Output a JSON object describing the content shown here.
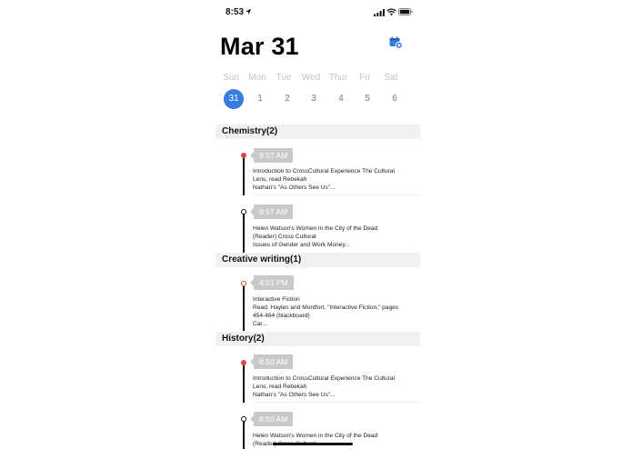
{
  "status_bar": {
    "time": "8:53"
  },
  "header": {
    "title": "Mar 31"
  },
  "week": {
    "days": [
      "Sun",
      "Mon",
      "Tue",
      "Wed",
      "Thur",
      "Fri",
      "Sat"
    ],
    "dates": [
      "31",
      "1",
      "2",
      "3",
      "4",
      "5",
      "6"
    ],
    "selected_index": 0
  },
  "sections": [
    {
      "title": "Chemistry(2)",
      "events": [
        {
          "time": "9:57 AM",
          "lines": [
            "Introduction to CrossCultural Experience The Cultural",
            "Lens, read Rebekah",
            "Nathan's \"As Others See Us\"..."
          ],
          "dot": "red"
        },
        {
          "time": "9:57 AM",
          "lines": [
            "Helen Watson's Women in the City of the Dead",
            "(Reader) Cross Cultural",
            "Issues of Gender and Work Money..."
          ],
          "dot": "hollow"
        }
      ]
    },
    {
      "title": "Creative writing(1)",
      "events": [
        {
          "time": "4:01 PM",
          "lines": [
            "Interactive Fiction",
            "Read: Hayles and Montfort, \"Interactive Fiction,\" pages",
            "454-464 (blackboard)",
            "Car..."
          ],
          "dot": "hollow-red"
        }
      ]
    },
    {
      "title": "History(2)",
      "events": [
        {
          "time": "8:50 AM",
          "lines": [
            "Introduction to CrossCultural Experience The Cultural",
            "Lens, read Rebekah",
            "Nathan's \"As Others See Us\"..."
          ],
          "dot": "red"
        },
        {
          "time": "8:50 AM",
          "lines": [
            "Helen Watson's Women in the City of the Dead",
            "(Reader) Cross Cultural"
          ],
          "dot": "hollow"
        }
      ]
    }
  ],
  "colors": {
    "accent": "#3a7be0",
    "dot_red": "#d94b3d",
    "badge_gray": "#c9c9c9",
    "section_bg": "#f1f1f1"
  },
  "icons": {
    "location": "location-arrow-icon",
    "signal": "signal-icon",
    "wifi": "wifi-icon",
    "battery": "battery-icon",
    "add_event": "calendar-add-icon"
  }
}
